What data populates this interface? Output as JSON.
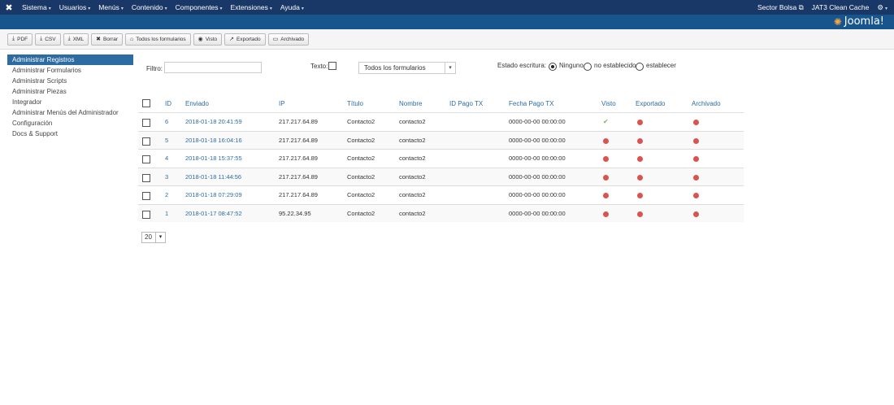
{
  "navbar": {
    "menu": [
      "Sistema",
      "Usuarios",
      "Menús",
      "Contenido",
      "Componentes",
      "Extensiones",
      "Ayuda"
    ],
    "right_site": "Sector Bolsa",
    "right_cache": "JAT3 Clean Cache"
  },
  "header": {
    "logo_text": "Joomla!"
  },
  "toolbar": {
    "pdf": "PDF",
    "csv": "CSV",
    "xml": "XML",
    "borrar": "Borrar",
    "todos": "Todos los formularios",
    "visto": "Visto",
    "exportado": "Exportado",
    "archivado": "Archivado"
  },
  "sidebar": {
    "items": [
      {
        "label": "Administrar Registros",
        "active": true
      },
      {
        "label": "Administrar Formularios"
      },
      {
        "label": "Administrar Scripts"
      },
      {
        "label": "Administrar Piezas"
      },
      {
        "label": "Integrador"
      },
      {
        "label": "Administrar Menús del Administrador"
      },
      {
        "label": "Configuración"
      },
      {
        "label": "Docs & Support"
      }
    ]
  },
  "filters": {
    "filtro_label": "Filtro:",
    "texto_label": "Texto:",
    "form_select": "Todos los formularios",
    "estado_label": "Estado escritura:",
    "opt_ninguno": "Ninguno",
    "opt_no_establecido": "no establecido",
    "opt_establecer": "establecer"
  },
  "table": {
    "headers": {
      "id": "ID",
      "enviado": "Enviado",
      "ip": "IP",
      "titulo": "Título",
      "nombre": "Nombre",
      "idpago": "ID Pago TX",
      "fechapago": "Fecha Pago TX",
      "visto": "Visto",
      "exportado": "Exportado",
      "archivado": "Archivado"
    },
    "rows": [
      {
        "id": "6",
        "enviado": "2018-01-18 20:41:59",
        "ip": "217.217.64.89",
        "titulo": "Contacto2",
        "nombre": "contacto2",
        "fecha": "0000-00-00 00:00:00",
        "visto": "ok"
      },
      {
        "id": "5",
        "enviado": "2018-01-18 16:04:16",
        "ip": "217.217.64.89",
        "titulo": "Contacto2",
        "nombre": "contacto2",
        "fecha": "0000-00-00 00:00:00",
        "visto": "no"
      },
      {
        "id": "4",
        "enviado": "2018-01-18 15:37:55",
        "ip": "217.217.64.89",
        "titulo": "Contacto2",
        "nombre": "contacto2",
        "fecha": "0000-00-00 00:00:00",
        "visto": "no"
      },
      {
        "id": "3",
        "enviado": "2018-01-18 11:44:56",
        "ip": "217.217.64.89",
        "titulo": "Contacto2",
        "nombre": "contacto2",
        "fecha": "0000-00-00 00:00:00",
        "visto": "no"
      },
      {
        "id": "2",
        "enviado": "2018-01-18 07:29:09",
        "ip": "217.217.64.89",
        "titulo": "Contacto2",
        "nombre": "contacto2",
        "fecha": "0000-00-00 00:00:00",
        "visto": "no"
      },
      {
        "id": "1",
        "enviado": "2018-01-17 08:47:52",
        "ip": "95.22.34.95",
        "titulo": "Contacto2",
        "nombre": "contacto2",
        "fecha": "0000-00-00 00:00:00",
        "visto": "no"
      }
    ]
  },
  "pagination": {
    "limit": "20"
  }
}
